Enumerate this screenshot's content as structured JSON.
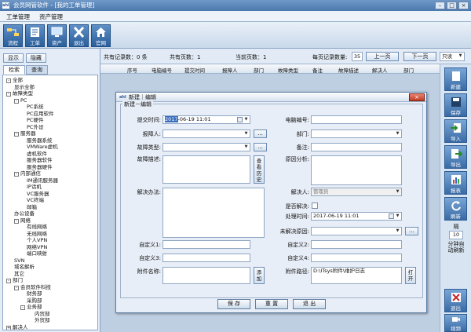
{
  "window": {
    "title": "会员网管软件 - [我的工单管理]",
    "icon_text": "ahI"
  },
  "menu": [
    "工单管理",
    "资产管理"
  ],
  "toolbar": [
    "流程",
    "工单",
    "资产",
    "退出",
    "官网"
  ],
  "left": {
    "show_btn": "显示",
    "hide_btn": "隐藏",
    "tabs": [
      "检索",
      "查询"
    ],
    "tree": [
      {
        "t": "全部",
        "box": "-"
      },
      {
        "t": "显示全部"
      },
      {
        "t": "故障类型",
        "box": "-"
      },
      {
        "t": "PC",
        "box": "-"
      },
      {
        "t": "PC系统"
      },
      {
        "t": "PC应用软件"
      },
      {
        "t": "PC硬件"
      },
      {
        "t": "PC外设"
      },
      {
        "t": "服务器",
        "box": "-"
      },
      {
        "t": "服务器系统"
      },
      {
        "t": "VMWare虚机"
      },
      {
        "t": "虚机软件"
      },
      {
        "t": "服务器软件"
      },
      {
        "t": "服务器硬件"
      },
      {
        "t": "内部通信",
        "box": "-"
      },
      {
        "t": "IM通讯服务器"
      },
      {
        "t": "IP话机"
      },
      {
        "t": "VC服务器"
      },
      {
        "t": "VC终端"
      },
      {
        "t": "邮箱"
      },
      {
        "t": "办公设备"
      },
      {
        "t": "网络",
        "box": "-"
      },
      {
        "t": "有线网络"
      },
      {
        "t": "无线网络"
      },
      {
        "t": "个人VPN"
      },
      {
        "t": "网络VPN"
      },
      {
        "t": "端口映射"
      },
      {
        "t": "SVN"
      },
      {
        "t": "域名解析"
      },
      {
        "t": "其它"
      },
      {
        "t": "部门",
        "box": "-"
      },
      {
        "t": "会员软件科技",
        "box": "-"
      },
      {
        "t": "财务部"
      },
      {
        "t": "采购部"
      },
      {
        "t": "业务部",
        "box": "-"
      },
      {
        "t": "内贸部"
      },
      {
        "t": "外贸部"
      },
      {
        "t": "解决人",
        "box": "+"
      }
    ]
  },
  "pager": {
    "total_records": "共有记录数：0 条",
    "total_pages": "共有页数：1",
    "current_page": "当前页数：1",
    "per_page_label": "每页记录数量:",
    "per_page_value": "35",
    "prev": "上一页",
    "next": "下一页",
    "filter": "只读"
  },
  "columns": [
    "序号",
    "电脑编号",
    "提交时间",
    "报障人",
    "部门",
    "故障类型",
    "备注",
    "故障描述",
    "解决人",
    "部门"
  ],
  "right_buttons": [
    "新建",
    "保存",
    "导入",
    "导出",
    "报表",
    "刷新"
  ],
  "right_interval": {
    "label": "隔",
    "value": "10",
    "label2": "分钟自动刷新"
  },
  "right_bottom_buttons": [
    "退出",
    "视频"
  ],
  "dialog": {
    "title": "新建｜编辑",
    "legend": "新建－编辑",
    "fields": {
      "submit_time": {
        "label": "提交时间:",
        "value_sel": "2017",
        "value": "-06-19 11:01"
      },
      "pc_no": {
        "label": "电脑编号:",
        "value": ""
      },
      "reporter": {
        "label": "报障人:",
        "value": ""
      },
      "dept": {
        "label": "部门:",
        "value": ""
      },
      "fault_type": {
        "label": "故障类型:",
        "value": ""
      },
      "note": {
        "label": "备注:",
        "value": ""
      },
      "fault_desc": {
        "label": "故障描述:",
        "value": ""
      },
      "cause": {
        "label": "原因分析:",
        "value": ""
      },
      "solution": {
        "label": "解决办法:",
        "value": ""
      },
      "resolver": {
        "label": "解决人:",
        "value": "管理员"
      },
      "resolved": {
        "label": "是否解决:"
      },
      "handle_time": {
        "label": "处理时间:",
        "value": "2017-06-19 11:01"
      },
      "unresolved_reason": {
        "label": "未解决原因:",
        "value": ""
      },
      "custom1": {
        "label": "自定义1:"
      },
      "custom2": {
        "label": "自定义2:"
      },
      "custom3": {
        "label": "自定义3:"
      },
      "custom4": {
        "label": "自定义4:"
      },
      "attachment": {
        "label": "附件名称:",
        "value": ""
      },
      "attach_path": {
        "label": "附件路径:",
        "value": "D:\\ITsys附件\\维护日志"
      }
    },
    "view_history_btn": "查看历史",
    "add_btn": "添加",
    "open_btn": "打开",
    "ellipsis": "...",
    "buttons": [
      "保 存",
      "重 置",
      "退 出"
    ]
  }
}
